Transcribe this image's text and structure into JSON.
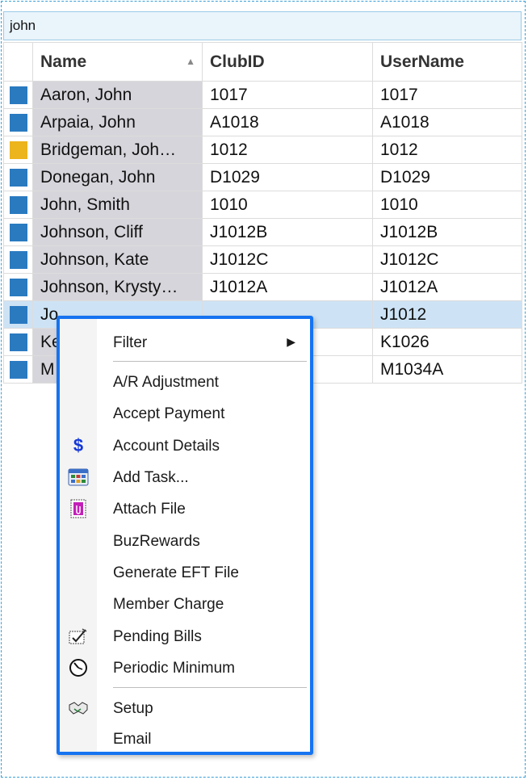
{
  "search": {
    "value": "john"
  },
  "grid": {
    "columns": [
      "Name",
      "ClubID",
      "UserName"
    ],
    "rows": [
      {
        "name": "Aaron, John",
        "club_id": "1017",
        "user_name": "1017",
        "color": "#2a7ac0"
      },
      {
        "name": "Arpaia, John",
        "club_id": "A1018",
        "user_name": "A1018",
        "color": "#2a7ac0"
      },
      {
        "name": "Bridgeman,  Joh…",
        "club_id": "1012",
        "user_name": "1012",
        "color": "#ecb41d"
      },
      {
        "name": "Donegan, John",
        "club_id": "D1029",
        "user_name": "D1029",
        "color": "#2a7ac0"
      },
      {
        "name": "John, Smith",
        "club_id": "1010",
        "user_name": "1010",
        "color": "#2a7ac0"
      },
      {
        "name": "Johnson, Cliff",
        "club_id": "J1012B",
        "user_name": "J1012B",
        "color": "#2a7ac0"
      },
      {
        "name": "Johnson, Kate",
        "club_id": "J1012C",
        "user_name": "J1012C",
        "color": "#2a7ac0"
      },
      {
        "name": "Johnson,  Krysty…",
        "club_id": "J1012A",
        "user_name": "J1012A",
        "color": "#2a7ac0"
      },
      {
        "name": "Jo",
        "club_id": "",
        "user_name": "J1012",
        "color": "#2a7ac0"
      },
      {
        "name": "Ke",
        "club_id": "",
        "user_name": "K1026",
        "color": "#2a7ac0"
      },
      {
        "name": "M",
        "club_id": "",
        "user_name": "M1034A",
        "color": "#2a7ac0"
      }
    ]
  },
  "context_menu": {
    "items": [
      {
        "label": "Filter",
        "icon": ""
      },
      {
        "label": "A/R Adjustment",
        "icon": ""
      },
      {
        "label": "Accept Payment",
        "icon": ""
      },
      {
        "label": "Account Details",
        "icon": "dollar-icon"
      },
      {
        "label": "Add Task...",
        "icon": "calendar-icon"
      },
      {
        "label": "Attach File",
        "icon": "attach-file-icon"
      },
      {
        "label": "BuzRewards",
        "icon": ""
      },
      {
        "label": "Generate EFT File",
        "icon": ""
      },
      {
        "label": "Member Charge",
        "icon": ""
      },
      {
        "label": "Pending Bills",
        "icon": "pending-bills-icon"
      },
      {
        "label": "Periodic Minimum",
        "icon": "clock-icon"
      },
      {
        "label": "Setup",
        "icon": "handshake-icon"
      },
      {
        "label": "Email",
        "icon": ""
      }
    ]
  }
}
